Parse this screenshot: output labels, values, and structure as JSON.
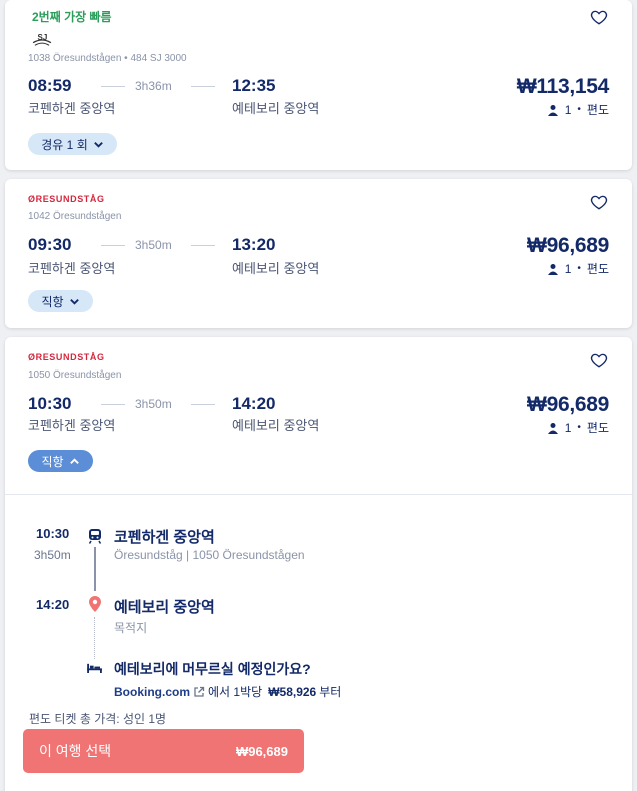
{
  "trips": [
    {
      "badge": "2번째 가장 빠름",
      "operator_icon": "sj-logo",
      "train_info": "1038 Öresundstågen • 484 SJ 3000",
      "depart_time": "08:59",
      "duration": "3h36m",
      "arrive_time": "12:35",
      "from_station": "코펜하겐 중앙역",
      "to_station": "예테보리 중앙역",
      "price": "₩113,154",
      "passengers": "1",
      "trip_type": "편도",
      "stops_label": "경유 1 회"
    },
    {
      "operator_name": "ØRESUNDSTÅG",
      "train_info": "1042 Öresundstågen",
      "depart_time": "09:30",
      "duration": "3h50m",
      "arrive_time": "13:20",
      "from_station": "코펜하겐 중앙역",
      "to_station": "예테보리 중앙역",
      "price": "₩96,689",
      "passengers": "1",
      "trip_type": "편도",
      "stops_label": "직항"
    },
    {
      "operator_name": "ØRESUNDSTÅG",
      "train_info": "1050 Öresundstågen",
      "depart_time": "10:30",
      "duration": "3h50m",
      "arrive_time": "14:20",
      "from_station": "코펜하겐 중앙역",
      "to_station": "예테보리 중앙역",
      "price": "₩96,689",
      "passengers": "1",
      "trip_type": "편도",
      "stops_label": "직항"
    }
  ],
  "details": {
    "depart_time": "10:30",
    "duration": "3h50m",
    "from_station": "코펜하겐 중앙역",
    "from_sub": "Öresundståg | 1050 Öresundstågen",
    "arrive_time": "14:20",
    "to_station": "예테보리 중앙역",
    "to_sub": "목적지",
    "hotel_question": "예테보리에 머무르실 예정인가요?",
    "booking_brand": "Booking.com",
    "hotel_price_text": "에서 1박당",
    "hotel_price": "₩58,926",
    "hotel_price_suffix": "부터",
    "fare_summary": "편도 티켓 총 가격: 성인 1명",
    "select_label": "이 여행 선택",
    "select_price": "₩96,689"
  },
  "colors": {
    "navy": "#132968",
    "accent_green": "#2a9d5a",
    "oresund_red": "#d3273e",
    "select_button": "#f07473",
    "pill_bg": "#d6e7f7",
    "pill_active": "#5b8ed6"
  }
}
